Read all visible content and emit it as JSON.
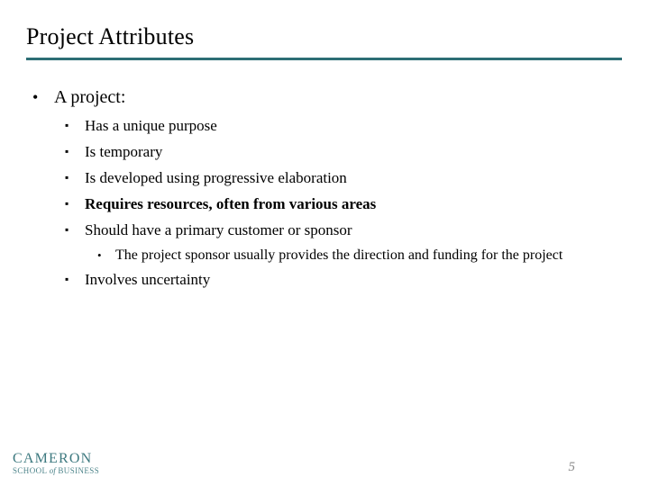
{
  "slide": {
    "title": "Project Attributes",
    "rule_color": "#2d6e75",
    "background_color": "#ffffff",
    "page_number": "5"
  },
  "bullets": {
    "lvl1_marker": "•",
    "lvl2_marker": "▪",
    "lvl3_marker": "•",
    "items": [
      {
        "level": 1,
        "text": "A project:",
        "bold": false
      },
      {
        "level": 2,
        "text": "Has a unique purpose",
        "bold": false
      },
      {
        "level": 2,
        "text": "Is temporary",
        "bold": false
      },
      {
        "level": 2,
        "text": "Is developed using progressive elaboration",
        "bold": false
      },
      {
        "level": 2,
        "text": "Requires resources, often from various areas",
        "bold": true
      },
      {
        "level": 2,
        "text": "Should have a primary customer or sponsor",
        "bold": false
      },
      {
        "level": 3,
        "text": "The project sponsor usually provides the direction and funding for the project",
        "bold": false
      },
      {
        "level": 2,
        "text": "Involves uncertainty",
        "bold": false
      }
    ]
  },
  "logo": {
    "main": "CAMERON",
    "sub_pre": "SCHOOL ",
    "sub_italic": "of",
    "sub_post": " BUSINESS",
    "color": "#2d6e75"
  }
}
